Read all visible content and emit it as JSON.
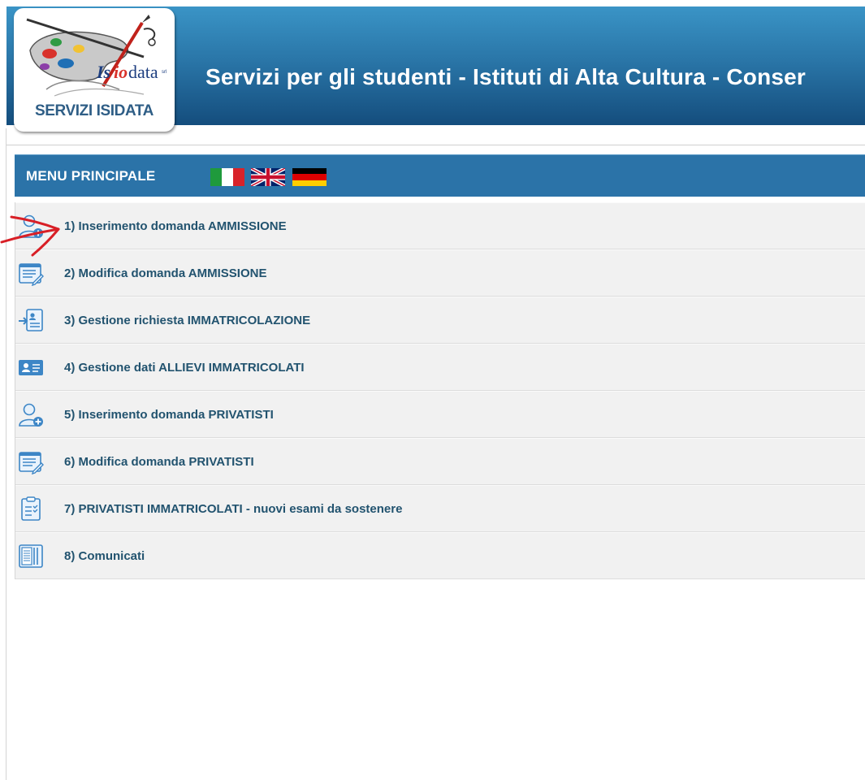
{
  "header": {
    "title": "Servizi per gli studenti - Istituti di Alta Cultura - Conser",
    "logo_label": "SERVIZI ISIDATA",
    "logo_text": "Isiodata"
  },
  "menu": {
    "title": "MENU PRINCIPALE",
    "flags": [
      "italian-flag",
      "uk-flag",
      "german-flag"
    ],
    "items": [
      {
        "label": "1) Inserimento domanda AMMISSIONE",
        "icon": "user-add-icon"
      },
      {
        "label": "2) Modifica domanda AMMISSIONE",
        "icon": "edit-form-icon"
      },
      {
        "label": "3) Gestione richiesta IMMATRICOLAZIONE",
        "icon": "import-contact-icon"
      },
      {
        "label": "4) Gestione dati ALLIEVI IMMATRICOLATI",
        "icon": "id-card-icon"
      },
      {
        "label": "5) Inserimento domanda PRIVATISTI",
        "icon": "user-add-icon"
      },
      {
        "label": "6) Modifica domanda PRIVATISTI",
        "icon": "edit-form-icon"
      },
      {
        "label": "7) PRIVATISTI IMMATRICOLATI - nuovi esami da sostenere",
        "icon": "clipboard-checklist-icon"
      },
      {
        "label": "8) Comunicati",
        "icon": "newspaper-icon"
      }
    ]
  },
  "colors": {
    "header_top": "#3a94c6",
    "header_bottom": "#144d7d",
    "menu_header": "#2b73a8",
    "menu_item_bg": "#f1f1f1",
    "menu_text": "#22536f",
    "annotation": "#d81f26"
  }
}
